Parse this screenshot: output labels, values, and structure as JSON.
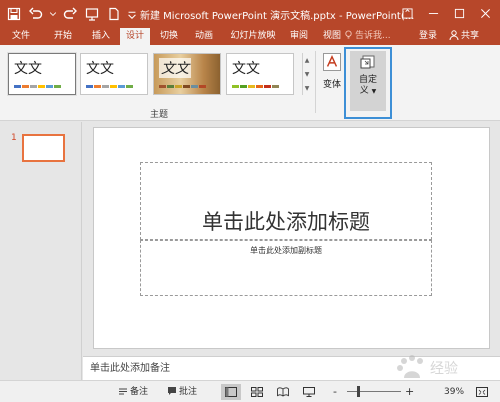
{
  "window": {
    "title": "新建 Microsoft PowerPoint 演示文稿.pptx - PowerPoint(..."
  },
  "tabs": [
    {
      "label": "文件",
      "active": false
    },
    {
      "label": "开始",
      "active": false
    },
    {
      "label": "插入",
      "active": false
    },
    {
      "label": "设计",
      "active": true
    },
    {
      "label": "切换",
      "active": false
    },
    {
      "label": "动画",
      "active": false
    },
    {
      "label": "幻灯片放映",
      "active": false
    },
    {
      "label": "审阅",
      "active": false
    },
    {
      "label": "视图",
      "active": false
    }
  ],
  "tell_me": "告诉我...",
  "login": "登录",
  "share": "共享",
  "ribbon": {
    "themes_group_label": "主题",
    "theme_tile_text": "文文",
    "variants_label": "变体",
    "customize_label_line1": "自定",
    "customize_label_line2": "义"
  },
  "thumbnails": {
    "slide_number": "1"
  },
  "slide": {
    "title_placeholder": "单击此处添加标题",
    "subtitle_placeholder": "单击此处添加副标题"
  },
  "notes_placeholder": "单击此处添加备注",
  "statusbar": {
    "notes_label": "备注",
    "comments_label": "批注",
    "zoom_minus": "-",
    "zoom_plus": "+",
    "zoom_level": "39%"
  },
  "colors": {
    "accent": "#b7472a",
    "highlight_box": "#3d8fd6",
    "thumbnail_border": "#e8733f"
  }
}
